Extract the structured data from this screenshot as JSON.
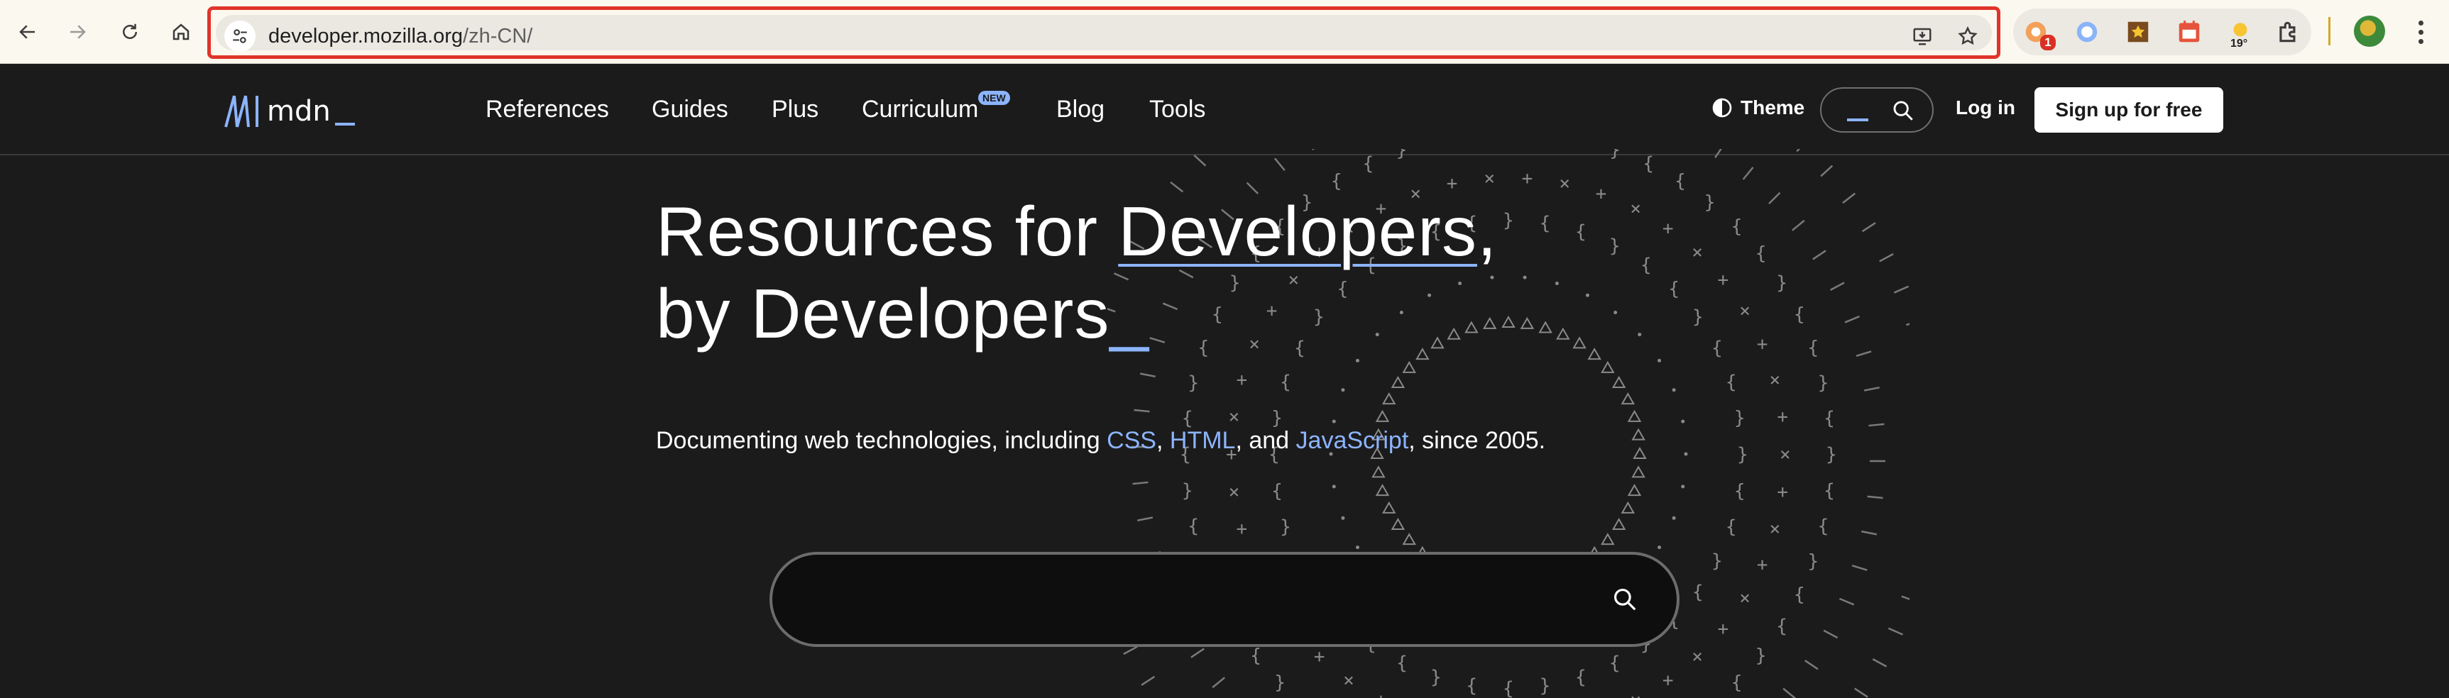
{
  "browser": {
    "url_host": "developer.mozilla.org",
    "url_path": "/zh-CN/",
    "extensions": [
      {
        "name": "notification-extension",
        "badge": "1"
      },
      {
        "name": "circle-extension"
      },
      {
        "name": "star-extension"
      },
      {
        "name": "calendar-extension"
      },
      {
        "name": "weather-extension",
        "temp": "19°"
      },
      {
        "name": "puzzle-icon"
      }
    ]
  },
  "header": {
    "logo_text": "mdn",
    "nav": [
      "References",
      "Guides",
      "Plus",
      "Curriculum",
      "Blog",
      "Tools"
    ],
    "new_badge": "NEW",
    "theme_label": "Theme",
    "login_label": "Log in",
    "signup_label": "Sign up for free"
  },
  "hero": {
    "title_line1_a": "Resources for ",
    "title_line1_b": "Developers",
    "title_line1_c": ",",
    "title_line2": "by Developers",
    "title_cursor": "_",
    "sub_a": "Documenting web technologies, including ",
    "sub_css": "CSS",
    "sub_sep1": ", ",
    "sub_html": "HTML",
    "sub_sep2": ", and ",
    "sub_js": "JavaScript",
    "sub_end": ", since 2005."
  },
  "colors": {
    "accent": "#8cb4ff",
    "background": "#1b1b1b",
    "url_highlight": "#e0342a"
  }
}
